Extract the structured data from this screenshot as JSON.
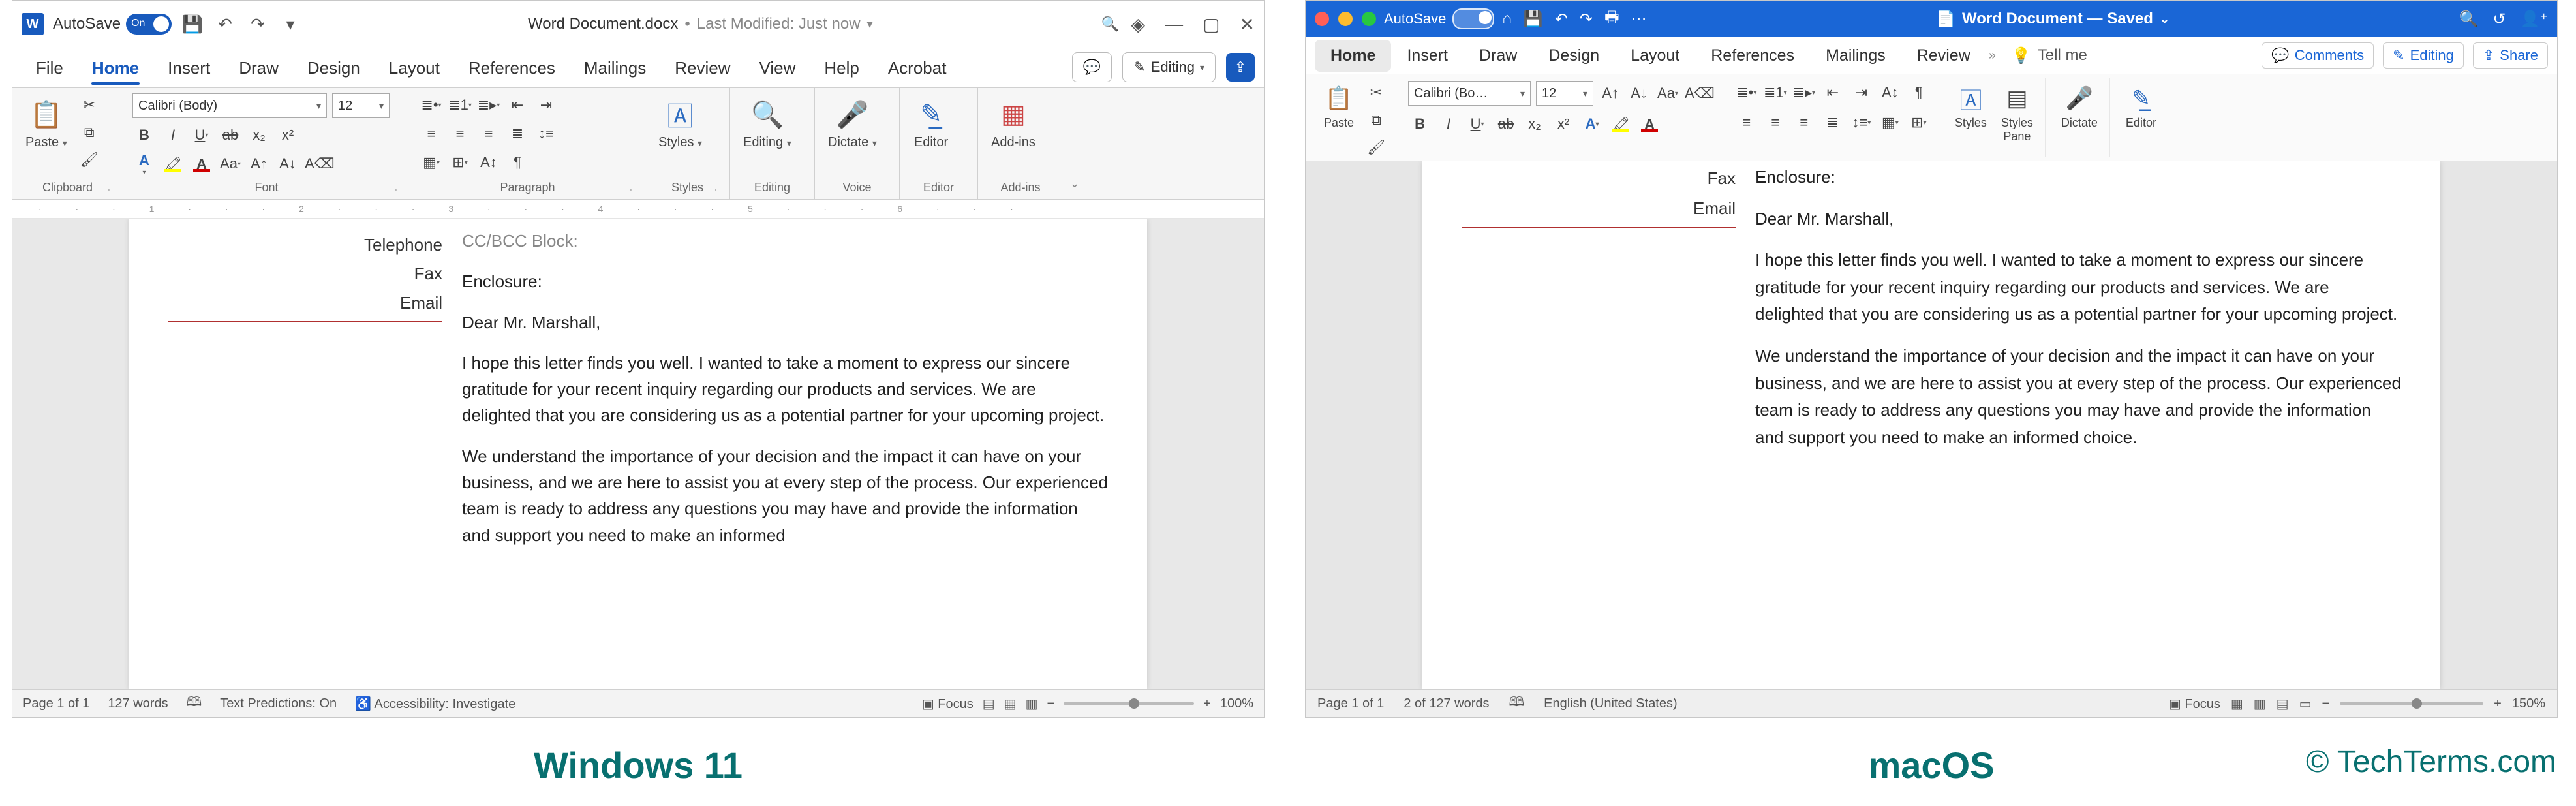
{
  "captions": {
    "win": "Windows 11",
    "mac": "macOS",
    "credit": "© TechTerms.com"
  },
  "win": {
    "title": {
      "autosave_label": "AutoSave",
      "toggle_state": "On",
      "file_name": "Word Document.docx",
      "separator": "•",
      "saved": "Last Modified: Just now"
    },
    "tabs": [
      "File",
      "Home",
      "Insert",
      "Draw",
      "Design",
      "Layout",
      "References",
      "Mailings",
      "Review",
      "View",
      "Help",
      "Acrobat"
    ],
    "tabs_active_index": 1,
    "tabs_right": {
      "editing": "Editing"
    },
    "ribbon": {
      "clipboard": {
        "label": "Clipboard",
        "paste": "Paste"
      },
      "font": {
        "label": "Font",
        "name": "Calibri (Body)",
        "size": "12",
        "buttons": [
          "B",
          "I",
          "U",
          "ab",
          "x₂",
          "x²"
        ]
      },
      "paragraph": {
        "label": "Paragraph"
      },
      "styles": {
        "label": "Styles",
        "btn": "Styles"
      },
      "editing": {
        "label": "Editing",
        "btn": "Editing"
      },
      "voice": {
        "label": "Voice",
        "btn": "Dictate"
      },
      "editor": {
        "label": "Editor",
        "btn": "Editor"
      },
      "addins": {
        "label": "Add-ins",
        "btn": "Add-ins"
      }
    },
    "doc": {
      "sender_labels": [
        "Telephone",
        "Fax",
        "Email"
      ],
      "cc": "CC/BCC Block:",
      "enclosure": "Enclosure:",
      "salutation": "Dear Mr. Marshall,",
      "p1": "I hope this letter finds you well. I wanted to take a moment to express our sincere gratitude for your recent inquiry regarding our products and services. We are delighted that you are considering us as a potential partner for your upcoming project.",
      "p2": "We understand the importance of your decision and the impact it can have on your business, and we are here to assist you at every step of the process. Our experienced team is ready to address any questions you may have and provide the information and support you need to make an informed"
    },
    "status": {
      "page": "Page 1 of 1",
      "words": "127 words",
      "predict": "Text Predictions: On",
      "accessibility": "Accessibility: Investigate",
      "focus": "Focus",
      "zoom": "100%"
    }
  },
  "mac": {
    "title": {
      "autosave_label": "AutoSave",
      "file_name": "Word Document — Saved"
    },
    "tabs": [
      "Home",
      "Insert",
      "Draw",
      "Design",
      "Layout",
      "References",
      "Mailings",
      "Review"
    ],
    "tabs_active_index": 0,
    "tellme": "Tell me",
    "tabs_right": {
      "comments": "Comments",
      "editing": "Editing",
      "share": "Share"
    },
    "ribbon": {
      "paste": "Paste",
      "font_name": "Calibri (Bo…",
      "font_size": "12",
      "styles": "Styles",
      "stylespane": "Styles\nPane",
      "dictate": "Dictate",
      "editor": "Editor"
    },
    "doc": {
      "sender_labels": [
        "Fax",
        "Email"
      ],
      "enclosure": "Enclosure:",
      "salutation": "Dear Mr. Marshall,",
      "p1": "I hope this letter finds you well. I wanted to take a moment to express our sincere gratitude for your recent inquiry regarding our products and services. We are delighted that you are considering us as a potential partner for your upcoming project.",
      "p2": "We understand the importance of your decision and the impact it can have on your business, and we are here to assist you at every step of the process. Our experienced team is ready to address any questions you may have and provide the information and support you need to make an informed choice."
    },
    "status": {
      "page": "Page 1 of 1",
      "words": "2 of 127 words",
      "lang": "English (United States)",
      "focus": "Focus",
      "zoom": "150%"
    }
  }
}
